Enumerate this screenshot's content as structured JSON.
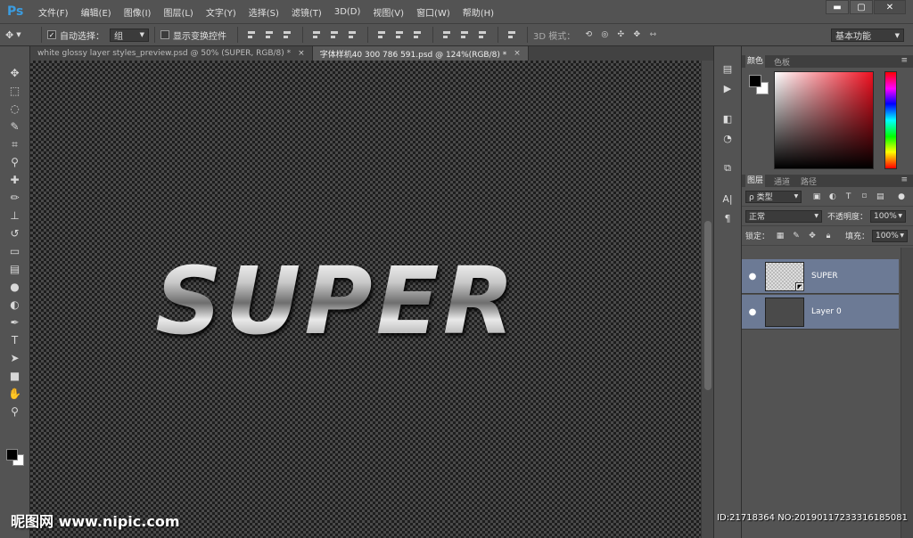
{
  "app": {
    "logo": "Ps"
  },
  "menu": [
    "文件(F)",
    "编辑(E)",
    "图像(I)",
    "图层(L)",
    "文字(Y)",
    "选择(S)",
    "滤镜(T)",
    "3D(D)",
    "视图(V)",
    "窗口(W)",
    "帮助(H)"
  ],
  "window_controls": {
    "minimize": "▬",
    "maximize": "▢",
    "close": "✕"
  },
  "options_bar": {
    "auto_select_label": "自动选择：",
    "auto_select_checked": true,
    "auto_select_value": "组",
    "show_transform_label": "显示变换控件",
    "mode_3d_label": "3D 模式：",
    "workspace": "基本功能"
  },
  "tabs": [
    {
      "label": "white glossy layer styles_preview.psd @ 50% (SUPER, RGB/8) *",
      "close": "×",
      "active": false
    },
    {
      "label": "字体样机40 300 786 591.psd @ 124%(RGB/8) *",
      "close": "×",
      "active": true
    }
  ],
  "canvas": {
    "text": "SUPER"
  },
  "color_panel": {
    "tabs": [
      "颜色",
      "色板"
    ],
    "menu": "≡"
  },
  "layers_panel": {
    "tabs": [
      "图层",
      "通道",
      "路径"
    ],
    "menu": "≡",
    "filter_kind": "ρ 类型",
    "blend_mode": "正常",
    "opacity_label": "不透明度：",
    "opacity_value": "100%",
    "lock_label": "锁定：",
    "fill_label": "填充：",
    "fill_value": "100%",
    "layers": [
      {
        "name": "SUPER",
        "visible_icon": "●",
        "thumb": "checker",
        "smart": "◩"
      },
      {
        "name": "Layer 0",
        "visible_icon": "●",
        "thumb": "dark"
      }
    ]
  },
  "watermark": {
    "left": "昵图网 www.nipic.com",
    "right": "ID:21718364 NO:20190117233316185081"
  }
}
